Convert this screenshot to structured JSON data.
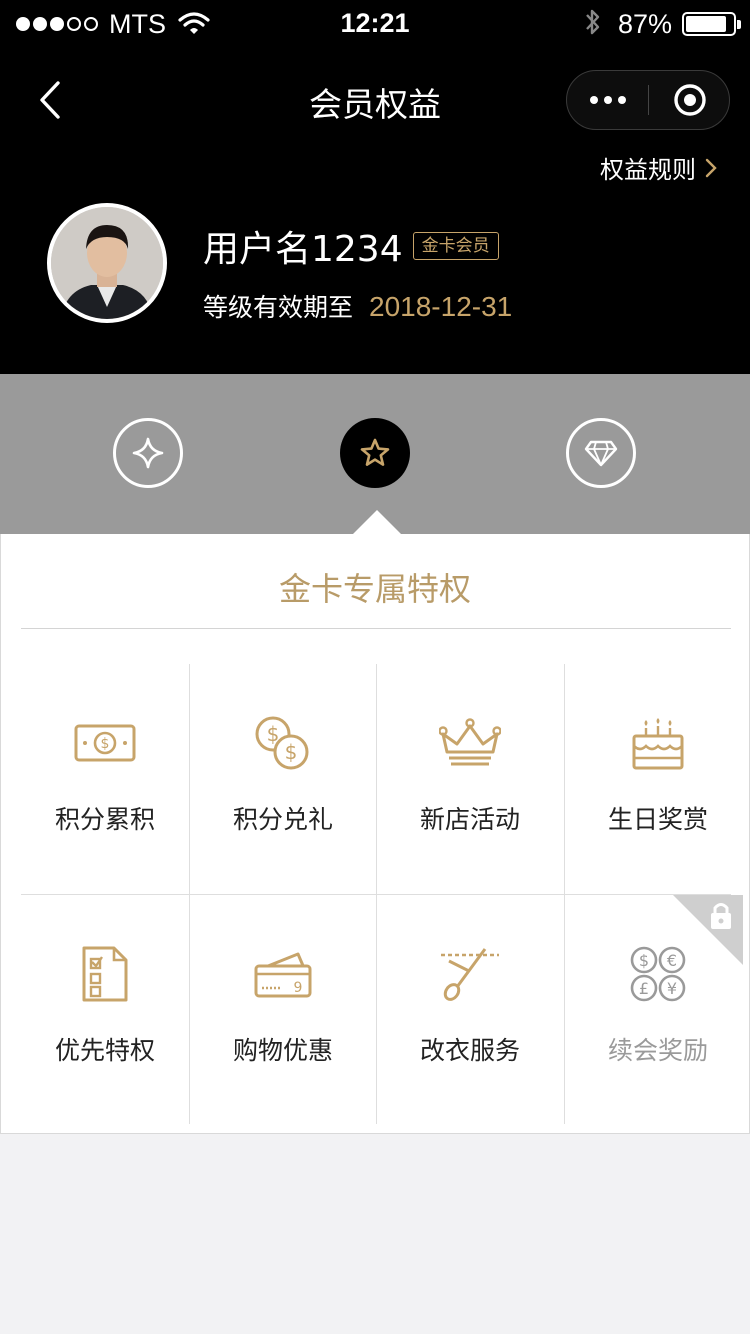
{
  "status_bar": {
    "carrier": "MTS",
    "time": "12:21",
    "battery_percent": "87%",
    "battery_level": 0.87,
    "signal_bars_filled": 3,
    "signal_bars_total": 5
  },
  "nav": {
    "title": "会员权益",
    "back_icon": "chevron-left-icon",
    "more_icon": "more-dots-icon",
    "close_icon": "target-circle-icon"
  },
  "header": {
    "rules_link": "权益规则",
    "username": "用户名1234",
    "member_badge": "金卡会员",
    "expiry_label": "等级有效期至",
    "expiry_date": "2018-12-31"
  },
  "tiers": [
    {
      "icon": "sparkle-icon",
      "active": false
    },
    {
      "icon": "star-icon",
      "active": true
    },
    {
      "icon": "diamond-icon",
      "active": false
    }
  ],
  "panel": {
    "title": "金卡专属特权",
    "items": [
      {
        "label": "积分累积",
        "icon": "cash-icon",
        "locked": false
      },
      {
        "label": "积分兑礼",
        "icon": "coins-icon",
        "locked": false
      },
      {
        "label": "新店活动",
        "icon": "crown-icon",
        "locked": false
      },
      {
        "label": "生日奖赏",
        "icon": "cake-icon",
        "locked": false
      },
      {
        "label": "优先特权",
        "icon": "checklist-icon",
        "locked": false
      },
      {
        "label": "购物优惠",
        "icon": "cards-icon",
        "locked": false
      },
      {
        "label": "改衣服务",
        "icon": "scissors-icon",
        "locked": false
      },
      {
        "label": "续会奖励",
        "icon": "currencies-icon",
        "locked": true
      }
    ]
  },
  "colors": {
    "gold": "#c7a46a",
    "header_bg": "#000000",
    "tier_band": "#9a9a9a",
    "page_bg": "#f2f2f4"
  }
}
